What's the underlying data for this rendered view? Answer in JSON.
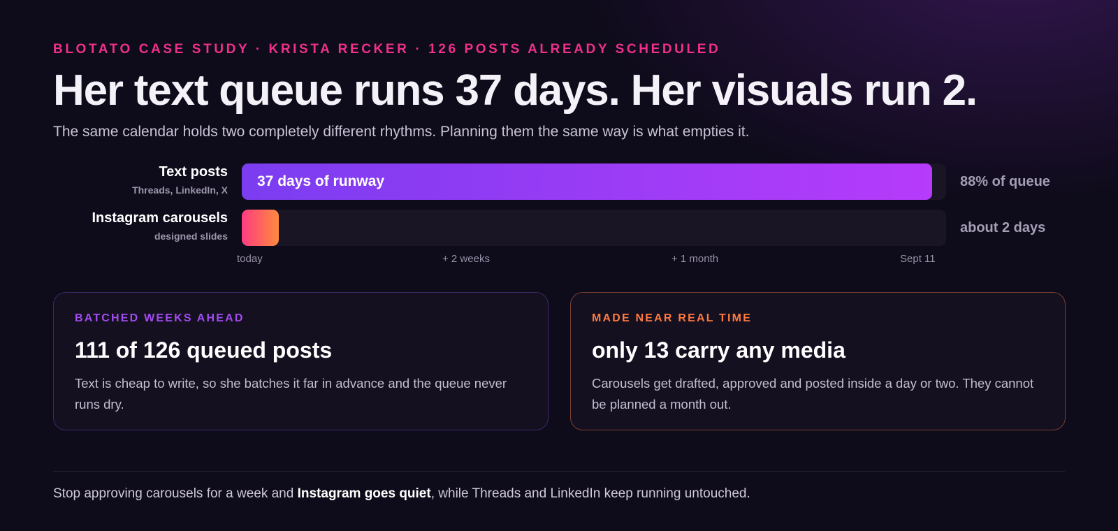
{
  "header": {
    "eyebrow": "BLOTATO CASE STUDY · KRISTA RECKER · 126 POSTS ALREADY SCHEDULED",
    "headline": "Her text queue runs 37 days. Her visuals run 2.",
    "subhead": "The same calendar holds two completely different rhythms. Planning them the same way is what empties it."
  },
  "timeline": {
    "rows": [
      {
        "title": "Text posts",
        "subtitle": "Threads, LinkedIn, X",
        "bar_label": "37 days of runway",
        "stat": "88% of queue",
        "runway_days": 37,
        "color_start": "#7b3df0",
        "color_end": "#b63bfb"
      },
      {
        "title": "Instagram carousels",
        "subtitle": "designed slides",
        "bar_label": "",
        "stat": "about 2 days",
        "runway_days": 2,
        "color_start": "#ff3c82",
        "color_end": "#ff8a3d"
      }
    ],
    "ticks": [
      "today",
      "+ 2 weeks",
      "+ 1 month",
      "Sept 11"
    ]
  },
  "cards": {
    "left": {
      "eyebrow": "BATCHED WEEKS AHEAD",
      "title": "111 of 126 queued posts",
      "body": "Text is cheap to write, so she batches it far in advance and the queue never runs dry.",
      "accent": "#a24cf2"
    },
    "right": {
      "eyebrow": "MADE NEAR REAL TIME",
      "title": "only 13 carry any media",
      "body": "Carousels get drafted, approved and posted inside a day or two. They cannot be planned a month out.",
      "accent": "#ff7a3f"
    }
  },
  "footer": {
    "before": "Stop approving carousels for a week and ",
    "emphasis": "Instagram goes quiet",
    "after": ", while Threads and LinkedIn keep running untouched."
  }
}
